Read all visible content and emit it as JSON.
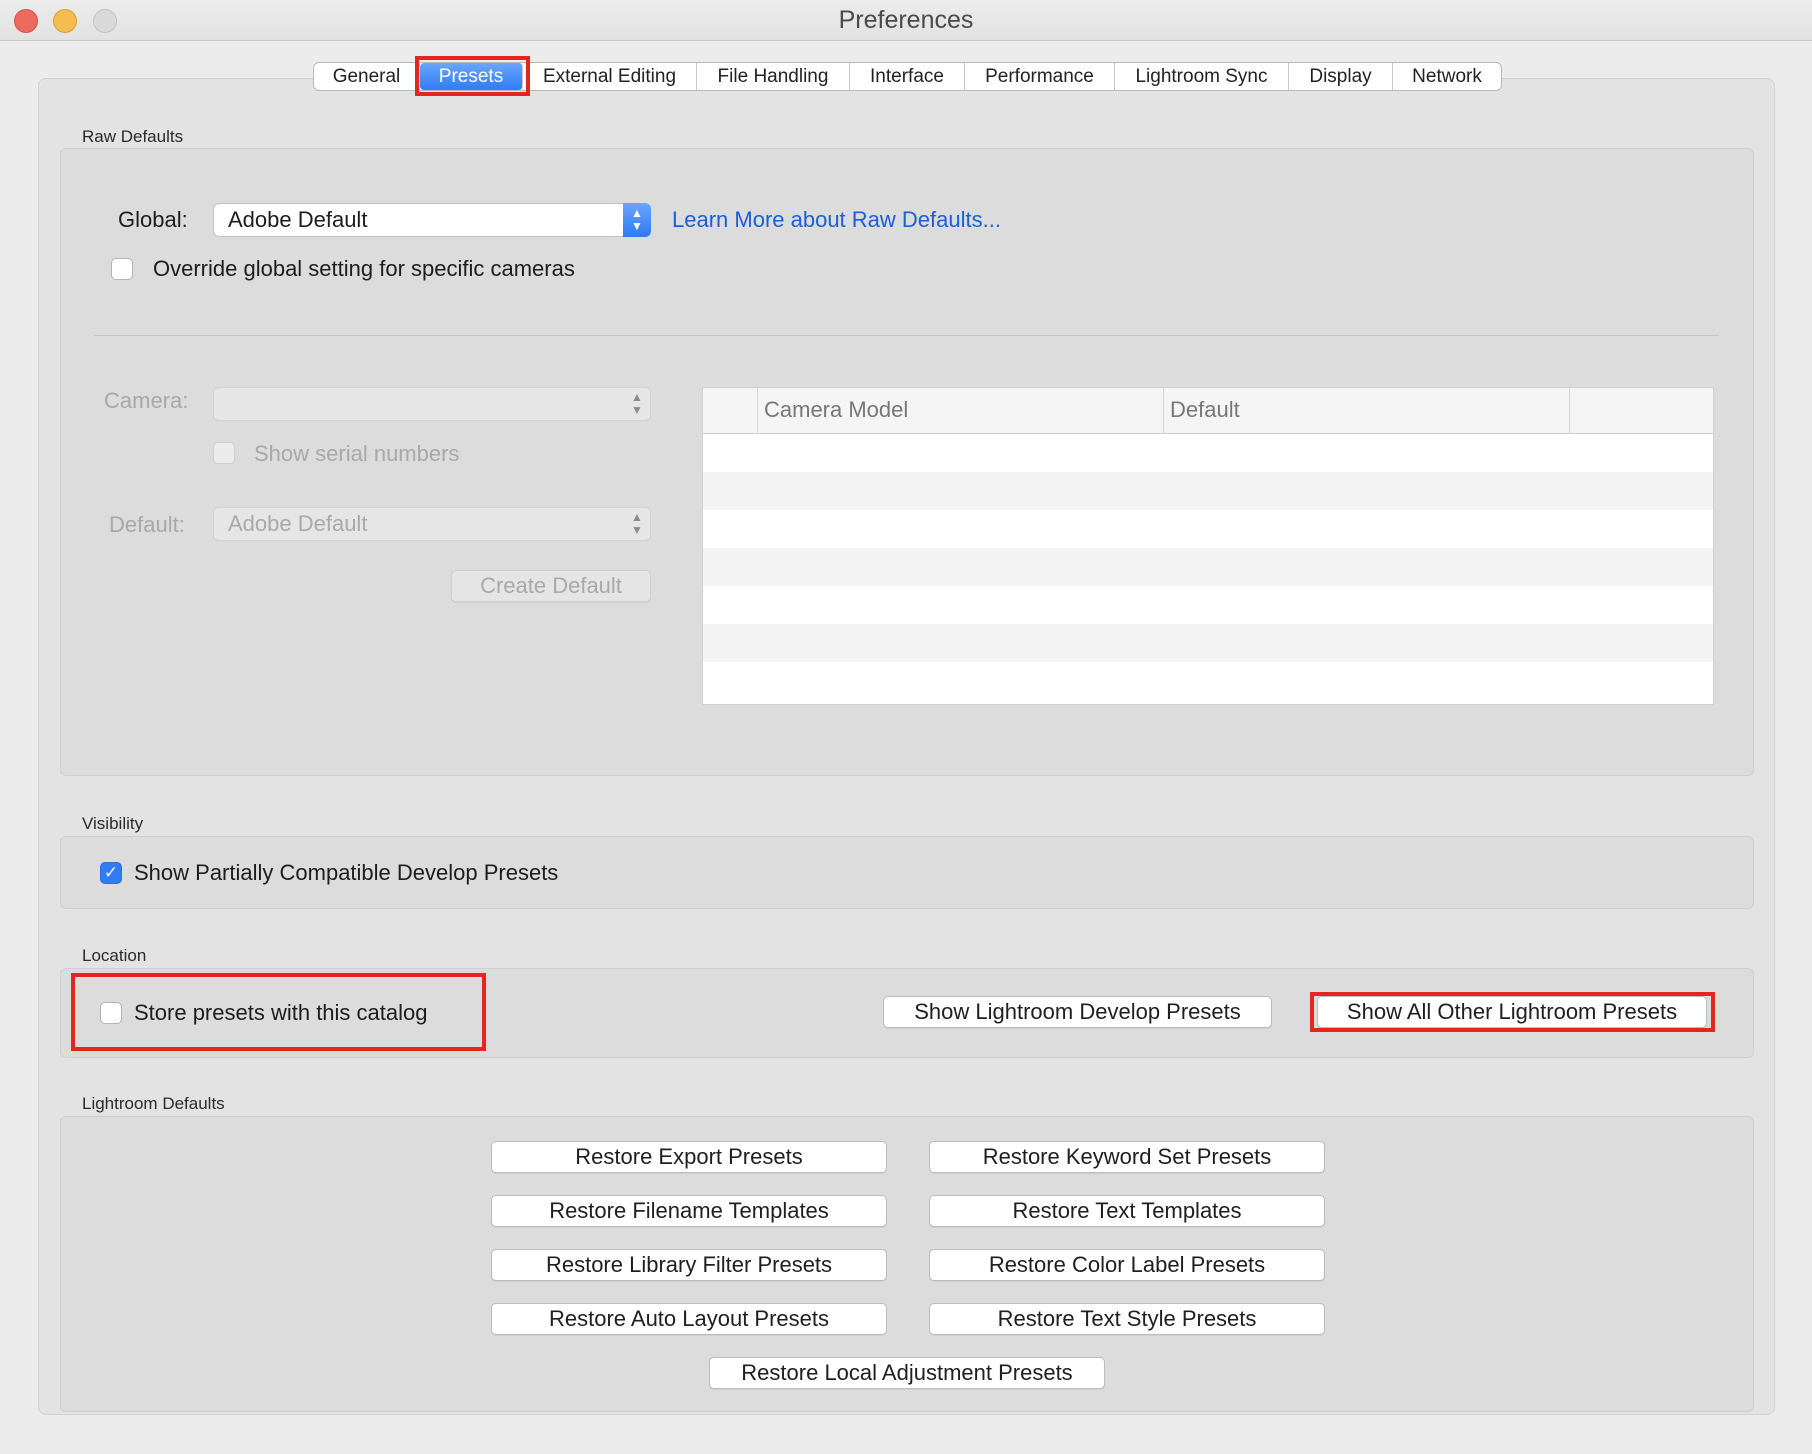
{
  "window": {
    "title": "Preferences"
  },
  "tabs": [
    "General",
    "Presets",
    "External Editing",
    "File Handling",
    "Interface",
    "Performance",
    "Lightroom Sync",
    "Display",
    "Network"
  ],
  "active_tab": "Presets",
  "raw_defaults": {
    "section_label": "Raw Defaults",
    "global_label": "Global:",
    "global_value": "Adobe Default",
    "learn_more_link": "Learn More about Raw Defaults...",
    "override_label": "Override global setting for specific cameras",
    "override_checked": false,
    "camera_label": "Camera:",
    "camera_value": "",
    "show_serial_label": "Show serial numbers",
    "default_label": "Default:",
    "default_value": "Adobe Default",
    "create_default_button": "Create Default",
    "table": {
      "columns": [
        "Camera Model",
        "Default"
      ],
      "rows": []
    }
  },
  "visibility": {
    "section_label": "Visibility",
    "show_partial_label": "Show Partially Compatible Develop Presets",
    "show_partial_checked": true
  },
  "location": {
    "section_label": "Location",
    "store_label": "Store presets with this catalog",
    "store_checked": false,
    "show_develop_button": "Show Lightroom Develop Presets",
    "show_all_button": "Show All Other Lightroom Presets"
  },
  "lightroom_defaults": {
    "section_label": "Lightroom Defaults",
    "buttons": {
      "export": "Restore Export Presets",
      "keyword_set": "Restore Keyword Set Presets",
      "filename": "Restore Filename Templates",
      "text_templates": "Restore Text Templates",
      "library_filter": "Restore Library Filter Presets",
      "color_label": "Restore Color Label Presets",
      "auto_layout": "Restore Auto Layout Presets",
      "text_style": "Restore Text Style Presets",
      "local_adjustment": "Restore Local Adjustment Presets"
    }
  },
  "colors": {
    "accent": "#2f7cf6",
    "link": "#1a5fd9",
    "highlight": "#e3261f"
  }
}
